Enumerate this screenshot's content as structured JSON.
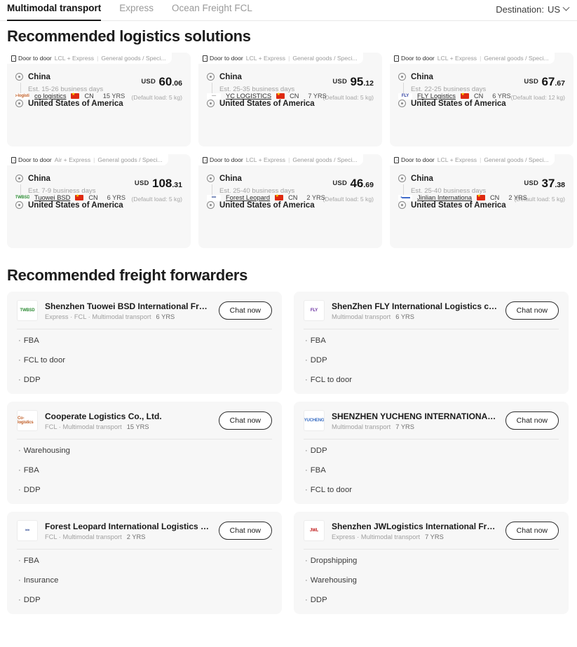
{
  "topbar": {
    "tabs": [
      {
        "label": "Multimodal transport",
        "active": true
      },
      {
        "label": "Express",
        "active": false
      },
      {
        "label": "Ocean Freight FCL",
        "active": false
      }
    ],
    "destination_label": "Destination:",
    "destination_value": "US",
    "chevron_icon": "chevron-down-icon"
  },
  "sections": {
    "solutions_title": "Recommended logistics solutions",
    "forwarders_title": "Recommended freight forwarders"
  },
  "solutions": [
    {
      "badge_mode": "Door to door",
      "badge_service": "LCL + Express",
      "badge_goods": "General goods / Speci...",
      "origin": "China",
      "eta": "Est. 15-26 business days",
      "destination": "United States of America",
      "currency": "USD",
      "price_int": "60",
      "price_dec": ".06",
      "load": "(Default load: 5 kg)",
      "supplier": "co logistics",
      "country": "CN",
      "years": "15 YRS",
      "logo_text": "Co-logistics",
      "logo_color": "#c2622c"
    },
    {
      "badge_mode": "Door to door",
      "badge_service": "LCL + Express",
      "badge_goods": "General goods / Speci...",
      "origin": "China",
      "eta": "Est. 25-35 business days",
      "destination": "United States of America",
      "currency": "USD",
      "price_int": "95",
      "price_dec": ".12",
      "load": "(Default load: 5 kg)",
      "supplier": "YC LOGISTICS",
      "country": "CN",
      "years": "7 YRS",
      "logo_text": "—",
      "logo_color": "#8a8a8a"
    },
    {
      "badge_mode": "Door to door",
      "badge_service": "LCL + Express",
      "badge_goods": "General goods / Speci...",
      "origin": "China",
      "eta": "Est. 22-25 business days",
      "destination": "United States of America",
      "currency": "USD",
      "price_int": "67",
      "price_dec": ".67",
      "load": "(Default load: 12 kg)",
      "supplier": "FLY Logistics",
      "country": "CN",
      "years": "6 YRS",
      "logo_text": "FLY",
      "logo_color": "#2f3fa0"
    },
    {
      "badge_mode": "Door to door",
      "badge_service": "Air + Express",
      "badge_goods": "General goods / Speci...",
      "origin": "China",
      "eta": "Est. 7-9 business days",
      "destination": "United States of America",
      "currency": "USD",
      "price_int": "108",
      "price_dec": ".31",
      "load": "(Default load: 5 kg)",
      "supplier": "Tuowei BSD",
      "country": "CN",
      "years": "6 YRS",
      "logo_text": "TWBSD",
      "logo_color": "#2e8b35"
    },
    {
      "badge_mode": "Door to door",
      "badge_service": "LCL + Express",
      "badge_goods": "General goods / Speci...",
      "origin": "China",
      "eta": "Est. 25-40 business days",
      "destination": "United States of America",
      "currency": "USD",
      "price_int": "46",
      "price_dec": ".69",
      "load": "(Default load: 5 kg)",
      "supplier": "Forest Leopard",
      "country": "CN",
      "years": "2 YRS",
      "logo_text": "≈≈",
      "logo_color": "#24408f"
    },
    {
      "badge_mode": "Door to door",
      "badge_service": "LCL + Express",
      "badge_goods": "General goods / Speci...",
      "origin": "China",
      "eta": "Est. 25-40 business days",
      "destination": "United States of America",
      "currency": "USD",
      "price_int": "37",
      "price_dec": ".38",
      "load": "(Default load: 5 kg)",
      "supplier": "Jinlian Internationa",
      "country": "CN",
      "years": "2 YRS",
      "logo_text": "▪▬▬",
      "logo_color": "#2b5bc4"
    }
  ],
  "forwarders": [
    {
      "name": "Shenzhen Tuowei BSD International Freig...",
      "subtitle": "Express · FCL · Multimodal transport",
      "years": "6 YRS",
      "chat_label": "Chat now",
      "services": [
        "FBA",
        "FCL to door",
        "DDP"
      ],
      "logo_text": "TWBSD",
      "logo_color": "#2e8b35"
    },
    {
      "name": "ShenZhen FLY International Logistics co.,...",
      "subtitle": "Multimodal transport",
      "years": "6 YRS",
      "chat_label": "Chat now",
      "services": [
        "FBA",
        "DDP",
        "FCL to door"
      ],
      "logo_text": "FLY",
      "logo_color": "#6a2fa0"
    },
    {
      "name": "Cooperate Logistics Co., Ltd.",
      "subtitle": "FCL · Multimodal transport",
      "years": "15 YRS",
      "chat_label": "Chat now",
      "services": [
        "Warehousing",
        "FBA",
        "DDP"
      ],
      "logo_text": "Co-logistics",
      "logo_color": "#c2622c"
    },
    {
      "name": "SHENZHEN YUCHENG INTERNATIONAL TR...",
      "subtitle": "Multimodal transport",
      "years": "7 YRS",
      "chat_label": "Chat now",
      "services": [
        "DDP",
        "FBA",
        "FCL to door"
      ],
      "logo_text": "YUCHENG",
      "logo_color": "#3b6fc4"
    },
    {
      "name": "Forest Leopard International Logistics Co...",
      "subtitle": "FCL · Multimodal transport",
      "years": "2 YRS",
      "chat_label": "Chat now",
      "services": [
        "FBA",
        "Insurance",
        "DDP"
      ],
      "logo_text": "≈≈",
      "logo_color": "#24408f"
    },
    {
      "name": "Shenzhen JWLogistics International Freig...",
      "subtitle": "Express · Multimodal transport",
      "years": "7 YRS",
      "chat_label": "Chat now",
      "services": [
        "Dropshipping",
        "Warehousing",
        "DDP"
      ],
      "logo_text": "JWL",
      "logo_color": "#c01a1a"
    }
  ]
}
